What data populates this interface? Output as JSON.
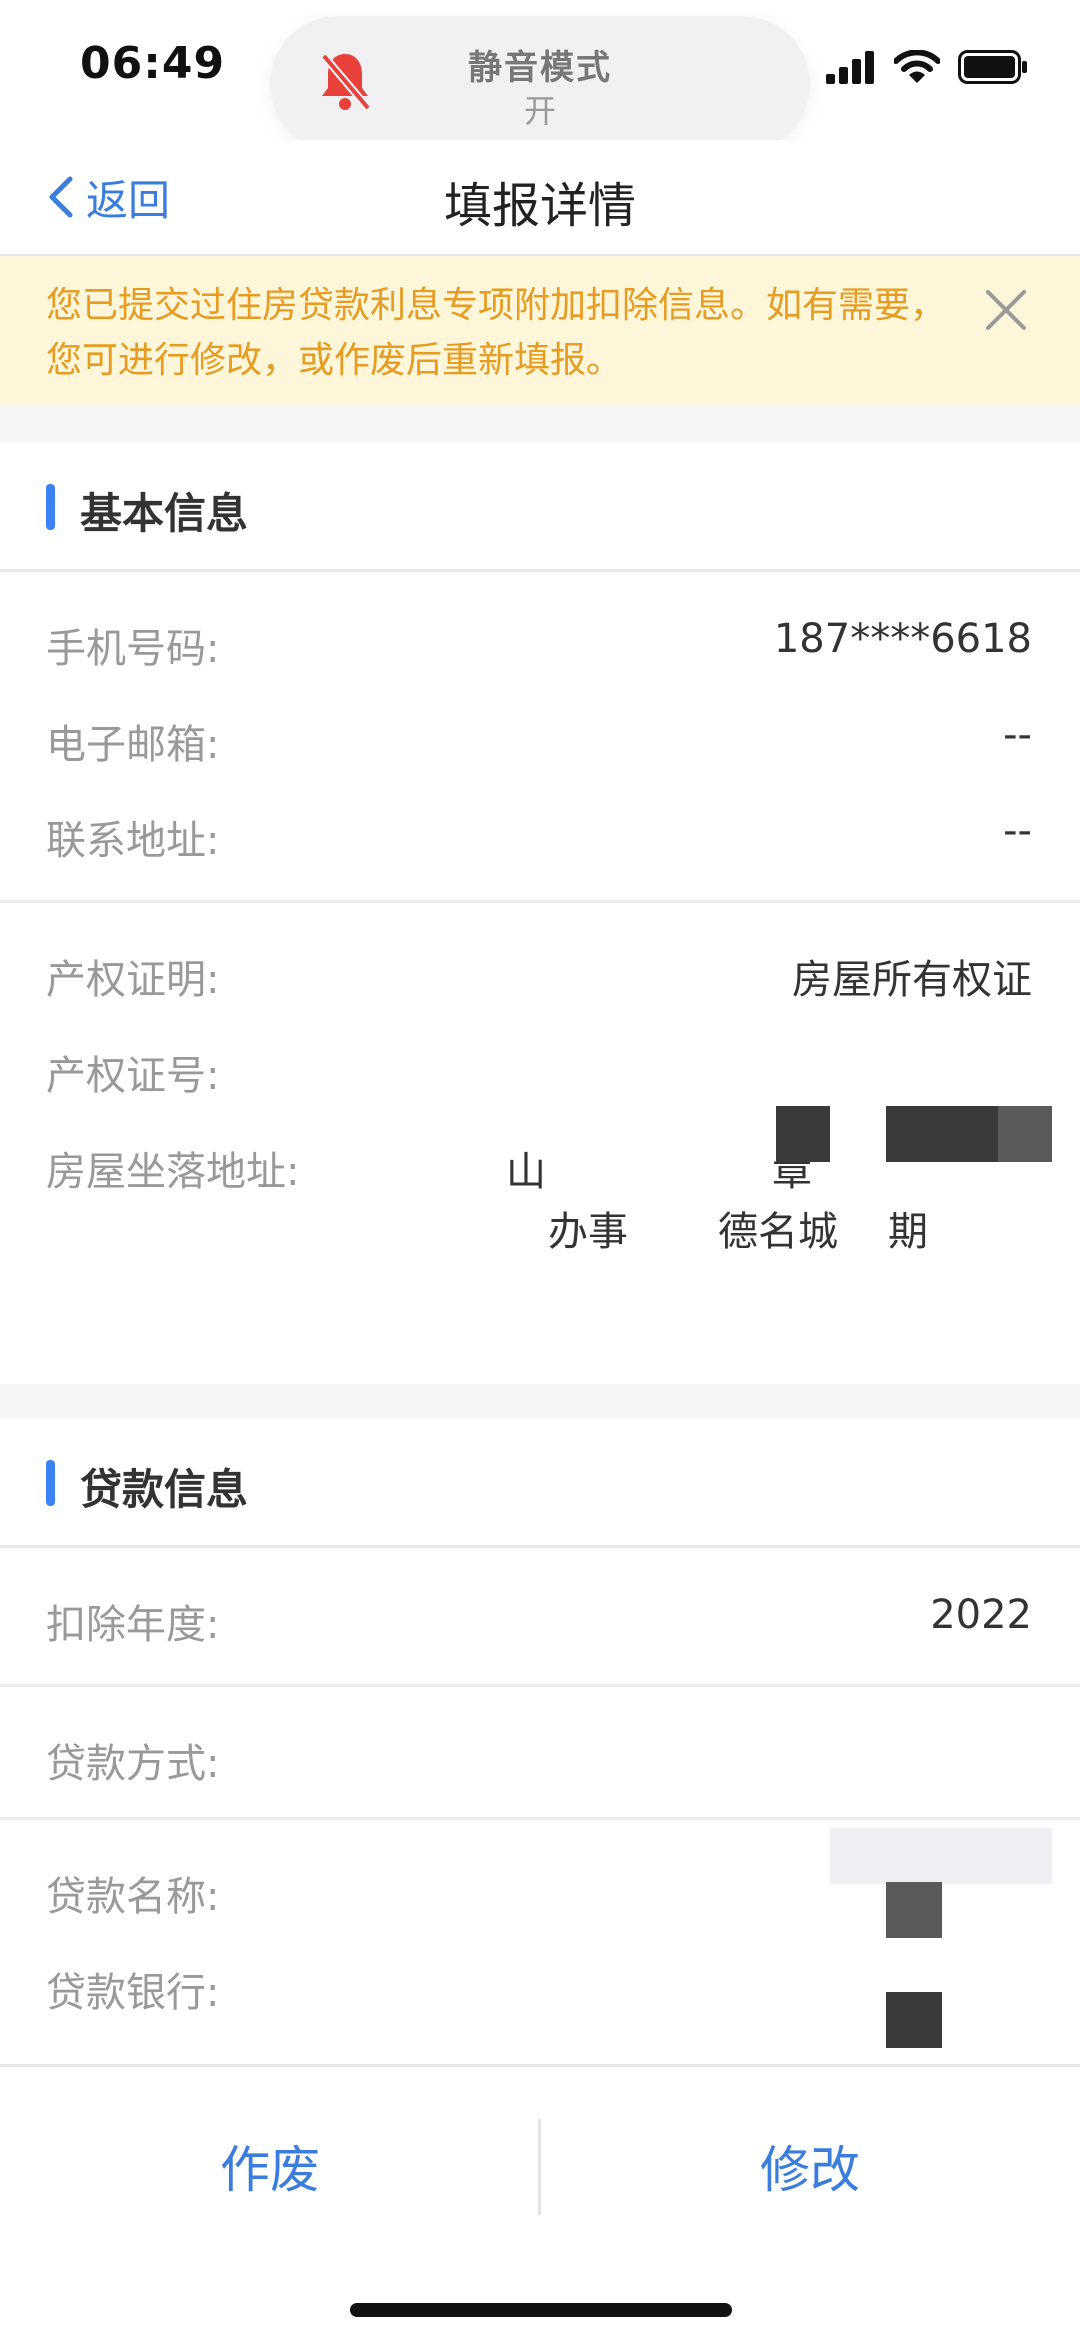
{
  "status": {
    "time": "06:49",
    "silent_title": "静音模式",
    "silent_state": "开"
  },
  "nav": {
    "back_label": "返回",
    "title": "填报详情"
  },
  "banner": {
    "text": "您已提交过住房贷款利息专项附加扣除信息。如有需要，您可进行修改，或作废后重新填报。"
  },
  "basic_info": {
    "title": "基本信息",
    "phone_label": "手机号码:",
    "phone_value": "187****6618",
    "email_label": "电子邮箱:",
    "email_value": "--",
    "address_label": "联系地址:",
    "address_value": "--",
    "cert_label": "产权证明:",
    "cert_value": "房屋所有权证",
    "cert_no_label": "产权证号:",
    "house_addr_label": "房屋坐落地址:",
    "house_addr_line1_a": "山",
    "house_addr_line1_b": "章",
    "house_addr_line2_a": "办事",
    "house_addr_line2_b": "德名城",
    "house_addr_line2_c": "期"
  },
  "loan_info": {
    "title": "贷款信息",
    "year_label": "扣除年度:",
    "year_value": "2022",
    "method_label": "贷款方式:",
    "name_label": "贷款名称:",
    "bank_label": "贷款银行:"
  },
  "bottom": {
    "void_label": "作废",
    "modify_label": "修改"
  }
}
